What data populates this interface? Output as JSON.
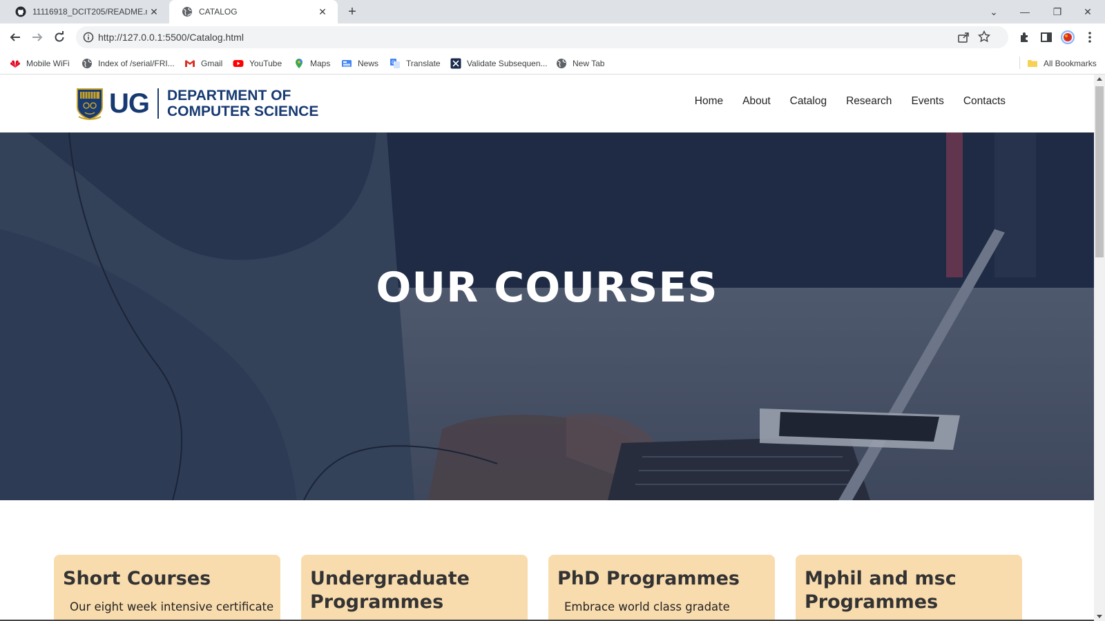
{
  "browser": {
    "tabs": [
      {
        "title": "11116918_DCIT205/README.md",
        "favicon": "github-icon",
        "active": false
      },
      {
        "title": "CATALOG",
        "favicon": "globe-icon",
        "active": true
      }
    ],
    "url": "http://127.0.0.1:5500/Catalog.html",
    "bookmarks": [
      {
        "label": "Mobile WiFi",
        "icon": "huawei-icon"
      },
      {
        "label": "Index of /serial/FRI...",
        "icon": "globe-icon"
      },
      {
        "label": "Gmail",
        "icon": "gmail-icon"
      },
      {
        "label": "YouTube",
        "icon": "youtube-icon"
      },
      {
        "label": "Maps",
        "icon": "maps-icon"
      },
      {
        "label": "News",
        "icon": "news-icon"
      },
      {
        "label": "Translate",
        "icon": "translate-icon"
      },
      {
        "label": "Validate Subsequen...",
        "icon": "x-icon"
      },
      {
        "label": "New Tab",
        "icon": "globe-icon"
      }
    ],
    "all_bookmarks": "All Bookmarks"
  },
  "site": {
    "logo": {
      "short": "UG",
      "line1": "DEPARTMENT OF",
      "line2": "COMPUTER SCIENCE"
    },
    "nav": [
      "Home",
      "About",
      "Catalog",
      "Research",
      "Events",
      "Contacts"
    ],
    "hero_title": "OUR COURSES",
    "cards": [
      {
        "title": "Short Courses",
        "text": "Our eight week intensive certificate"
      },
      {
        "title": "Undergraduate Programmes",
        "text": ""
      },
      {
        "title": "PhD Programmes",
        "text": "Embrace world class gradate"
      },
      {
        "title": "Mphil and msc Programmes",
        "text": ""
      }
    ]
  },
  "colors": {
    "brand_blue": "#173a72",
    "card_bg": "#f9dcae",
    "tabbar_bg": "#dee1e6"
  }
}
